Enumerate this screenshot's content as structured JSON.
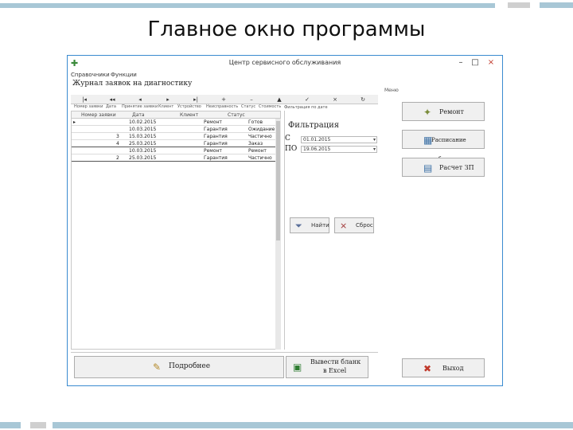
{
  "slide": {
    "title": "Главное окно программы"
  },
  "window": {
    "title": "Центр сервисного обслуживания",
    "controls": {
      "minimize": "–",
      "maximize": "□",
      "close": "×"
    },
    "menu": [
      "Справочники",
      "Функции"
    ],
    "doc_title": "Журнал заявок на диагностику"
  },
  "toolbar": {
    "buttons": [
      "|◂",
      "◂◂",
      "◂",
      "▸",
      "▸|",
      "+",
      "–",
      "▲",
      "✓",
      "×",
      "↻"
    ],
    "column_tabs": [
      "Номер заявки",
      "Дата",
      "Принятие заявки",
      "Клиент",
      "Устройство",
      "Неисправность",
      "Статус",
      "Стоимость"
    ]
  },
  "grid": {
    "headers": [
      "Номер заявки",
      "Дата",
      "Клиент",
      "Статус"
    ],
    "rows": [
      {
        "num": "",
        "date": "10.02.2015",
        "client": "Ремонт",
        "status": "Готов"
      },
      {
        "num": "",
        "date": "10.03.2015",
        "client": "Гарантия",
        "status": "Ожидание"
      },
      {
        "num": "3",
        "date": "15.03.2015",
        "client": "Гарантия",
        "status": "Частично"
      },
      {
        "num": "4",
        "date": "25.03.2015",
        "client": "Гарантия",
        "status": "Заказ"
      },
      {
        "num": "",
        "date": "10.03.2015",
        "client": "Ремонт",
        "status": "Ремонт"
      },
      {
        "num": "2",
        "date": "25.03.2015",
        "client": "Гарантия",
        "status": "Частично"
      }
    ]
  },
  "filter": {
    "panel_tab": "Фильтрация по дате",
    "title": "Фильтрация",
    "from_label": "С",
    "to_label": "ПО",
    "from_value": "01.01.2015",
    "to_value": "19.06.2015",
    "apply_label": "Найти",
    "reset_label": "Сброс"
  },
  "side": {
    "label": "Меню",
    "repair_label": "Ремонт",
    "schedule_label": "Расписание работ",
    "salary_label": "Расчет ЗП",
    "exit_label": "Выход"
  },
  "bottom": {
    "details_label": "Подробнее",
    "export_line1": "Вывести бланк",
    "export_line2": "в Excel"
  }
}
